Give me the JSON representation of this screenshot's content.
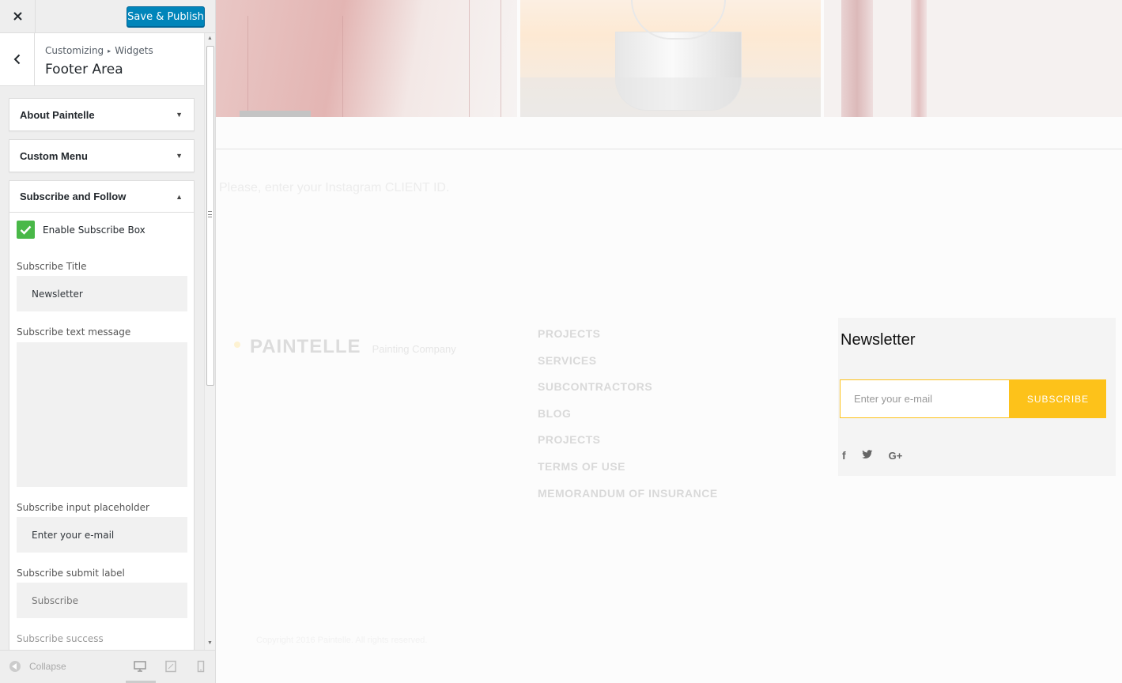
{
  "customizer": {
    "save_label": "Save & Publish",
    "breadcrumb": {
      "root": "Customizing",
      "sep": "▸",
      "current": "Widgets"
    },
    "section_title": "Footer Area",
    "widgets": [
      {
        "title": "About Paintelle",
        "arrow": "▼"
      },
      {
        "title": "Custom Menu",
        "arrow": "▼"
      },
      {
        "title": "Subscribe and Follow",
        "arrow": "▲"
      }
    ],
    "subscribe": {
      "enable_label": "Enable Subscribe Box",
      "enable_checked": true,
      "title_label": "Subscribe Title",
      "title_value": "Newsletter",
      "text_label": "Subscribe text message",
      "text_value": "",
      "placeholder_label": "Subscribe input placeholder",
      "placeholder_value": "Enter your e-mail",
      "submit_label": "Subscribe submit label",
      "submit_value": "Subscribe",
      "success_label": "Subscribe success"
    },
    "collapse_label": "Collapse"
  },
  "preview": {
    "instagram_note": "Please, enter your Instagram CLIENT ID.",
    "logo": {
      "name": "PAINTELLE",
      "tagline": "Painting Company"
    },
    "footer_menu": [
      "PROJECTS",
      "SERVICES",
      "SUBCONTRACTORS",
      "BLOG",
      "PROJECTS",
      "TERMS OF USE",
      "MEMORANDUM OF INSURANCE"
    ],
    "newsletter": {
      "title": "Newsletter",
      "placeholder": "Enter your e-mail",
      "button": "SUBSCRIBE",
      "social": [
        "f",
        "twitter",
        "G+"
      ]
    },
    "copyright": "Copyright 2016 Paintelle. All rights reserved."
  },
  "colors": {
    "accent": "#0085ba",
    "check": "#49b848",
    "subscribe": "#fdc21a"
  }
}
